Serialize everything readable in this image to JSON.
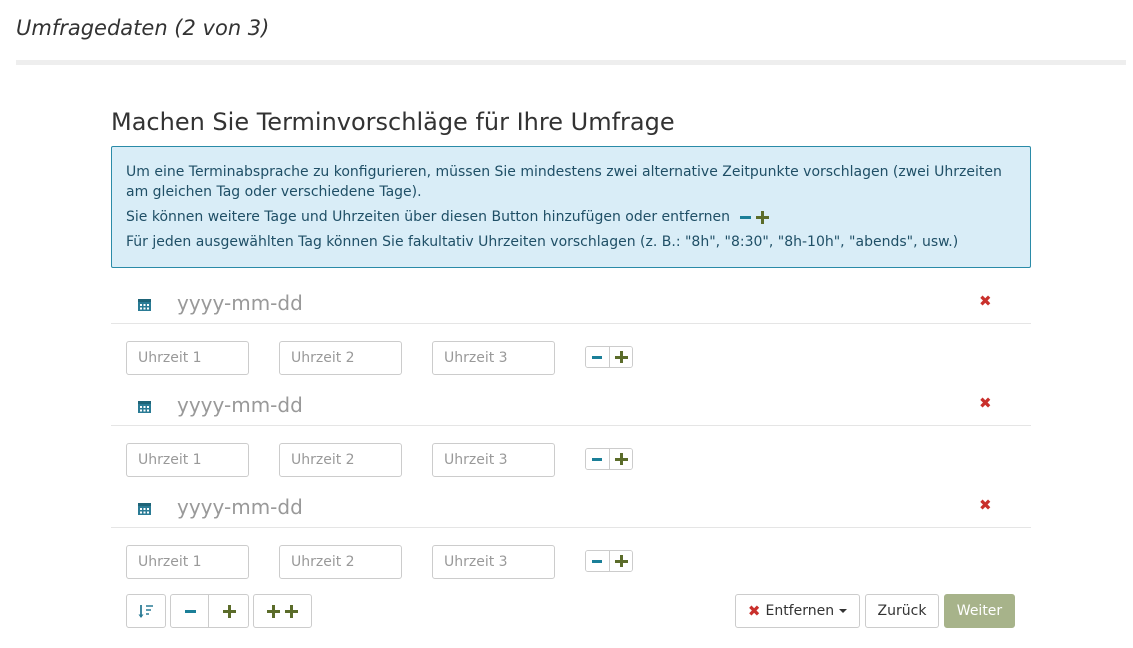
{
  "page": {
    "title": "Umfragedaten (2 von 3)"
  },
  "section": {
    "heading": "Machen Sie Terminvorschläge für Ihre Umfrage"
  },
  "info": {
    "line1": "Um eine Terminabsprache zu konfigurieren, müssen Sie mindestens zwei alternative Zeitpunkte vorschlagen (zwei Uhrzeiten am gleichen Tag oder verschiedene Tage).",
    "line2": "Sie können weitere Tage und Uhrzeiten über diesen Button hinzufügen oder entfernen",
    "line3": "Für jeden ausgewählten Tag können Sie fakultativ Uhrzeiten vorschlagen (z. B.: \"8h\", \"8:30\", \"8h-10h\", \"abends\", usw.)"
  },
  "days": [
    {
      "date_placeholder": "yyyy-mm-dd",
      "date_value": "",
      "times": [
        {
          "placeholder": "Uhrzeit 1",
          "value": ""
        },
        {
          "placeholder": "Uhrzeit 2",
          "value": ""
        },
        {
          "placeholder": "Uhrzeit 3",
          "value": ""
        }
      ]
    },
    {
      "date_placeholder": "yyyy-mm-dd",
      "date_value": "",
      "times": [
        {
          "placeholder": "Uhrzeit 1",
          "value": ""
        },
        {
          "placeholder": "Uhrzeit 2",
          "value": ""
        },
        {
          "placeholder": "Uhrzeit 3",
          "value": ""
        }
      ]
    },
    {
      "date_placeholder": "yyyy-mm-dd",
      "date_value": "",
      "times": [
        {
          "placeholder": "Uhrzeit 1",
          "value": ""
        },
        {
          "placeholder": "Uhrzeit 2",
          "value": ""
        },
        {
          "placeholder": "Uhrzeit 3",
          "value": ""
        }
      ]
    }
  ],
  "buttons": {
    "remove_label": "Entfernen",
    "back_label": "Zurück",
    "next_label": "Weiter"
  },
  "icons": {
    "calendar": "calendar-icon",
    "remove": "close-icon",
    "minus": "minus-icon",
    "plus": "plus-icon",
    "sort": "sort-icon"
  },
  "colors": {
    "info_bg": "#d9edf7",
    "info_border": "#2a8ba8",
    "remove_red": "#c9302c",
    "minus_teal": "#1b7f98",
    "plus_olive": "#5b6c2a",
    "next_button": "#a7b38a"
  }
}
